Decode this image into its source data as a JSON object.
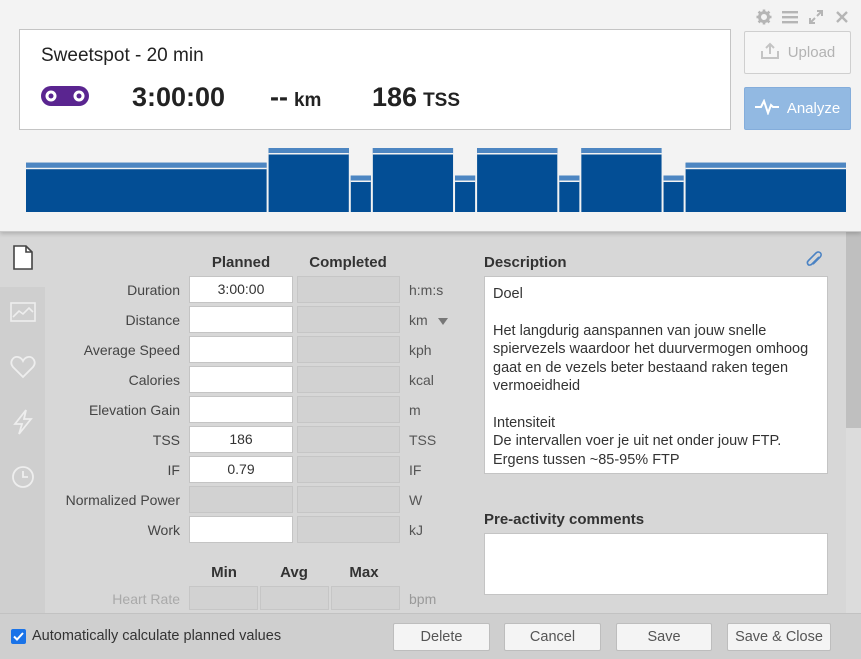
{
  "workout": {
    "title": "Sweetspot - 20 min",
    "sport_icon": "bike-chain-icon",
    "duration": "3:00:00",
    "distance": "--",
    "distance_unit": "km",
    "tss": "186",
    "tss_unit": "TSS"
  },
  "header_buttons": {
    "upload": "Upload",
    "analyze": "Analyze"
  },
  "window_controls": [
    "gear-icon",
    "menu-icon",
    "expand-icon",
    "close-icon"
  ],
  "colors": {
    "accent_blue": "#034e95",
    "analyze_button": "#92b9e2",
    "sport_purple": "#5a2590"
  },
  "sidebar_tabs": [
    "document-icon",
    "chart-icon",
    "heart-icon",
    "lightning-icon",
    "clock-icon"
  ],
  "form": {
    "col_planned": "Planned",
    "col_completed": "Completed",
    "rows": [
      {
        "label": "Duration",
        "planned": "3:00:00",
        "completed": "",
        "unit": "h:m:s"
      },
      {
        "label": "Distance",
        "planned": "",
        "completed": "",
        "unit": "km"
      },
      {
        "label": "Average Speed",
        "planned": "",
        "completed": "",
        "unit": "kph"
      },
      {
        "label": "Calories",
        "planned": "",
        "completed": "",
        "unit": "kcal"
      },
      {
        "label": "Elevation Gain",
        "planned": "",
        "completed": "",
        "unit": "m"
      },
      {
        "label": "TSS",
        "planned": "186",
        "completed": "",
        "unit": "TSS"
      },
      {
        "label": "IF",
        "planned": "0.79",
        "completed": "",
        "unit": "IF"
      },
      {
        "label": "Normalized Power",
        "planned": "",
        "completed": "",
        "unit": "W"
      },
      {
        "label": "Work",
        "planned": "",
        "completed": "",
        "unit": "kJ"
      }
    ],
    "hr_col_min": "Min",
    "hr_col_avg": "Avg",
    "hr_col_max": "Max",
    "hr_label": "Heart Rate",
    "hr_unit": "bpm"
  },
  "description": {
    "label": "Description",
    "text": "Doel\n\nHet langdurig aanspannen van jouw snelle spiervezels waardoor het duurvermogen omhoog gaat en de vezels beter bestaand raken tegen vermoeidheid\n\nIntensiteit\nDe intervallen voer je uit net onder jouw FTP.\nErgens tussen ~85-95% FTP"
  },
  "pre_activity": {
    "label": "Pre-activity comments",
    "text": ""
  },
  "footer": {
    "auto_calc_label": "Automatically calculate planned values",
    "auto_calc_checked": true,
    "delete": "Delete",
    "cancel": "Cancel",
    "save": "Save",
    "save_close": "Save & Close"
  },
  "workout_profile": {
    "segments": [
      {
        "minutes": 60,
        "intensity": 0.77
      },
      {
        "minutes": 20,
        "intensity": 1.0
      },
      {
        "minutes": 5,
        "intensity": 0.57
      },
      {
        "minutes": 20,
        "intensity": 1.0
      },
      {
        "minutes": 5,
        "intensity": 0.57
      },
      {
        "minutes": 20,
        "intensity": 1.0
      },
      {
        "minutes": 5,
        "intensity": 0.57
      },
      {
        "minutes": 20,
        "intensity": 1.0
      },
      {
        "minutes": 5,
        "intensity": 0.57
      },
      {
        "minutes": 40,
        "intensity": 0.77
      }
    ]
  }
}
